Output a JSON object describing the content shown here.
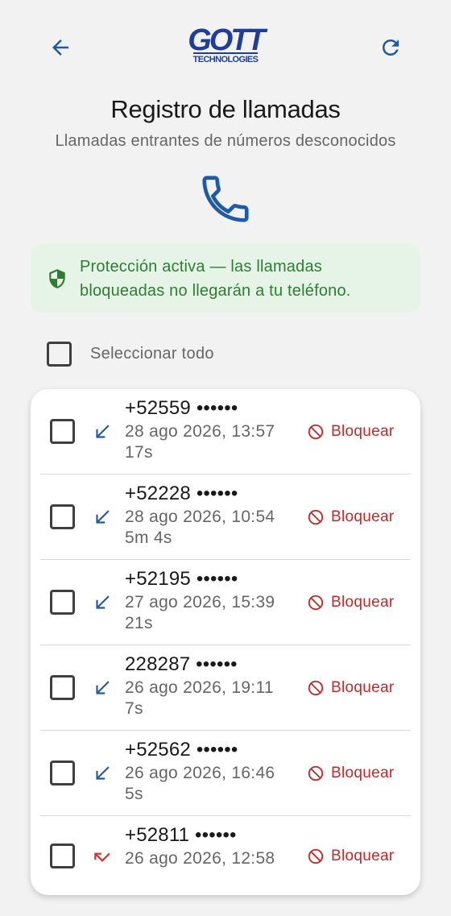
{
  "header": {
    "logo_main": "GOTT",
    "logo_sub": "TECHNOLOGIES",
    "title": "Registro de llamadas",
    "subtitle": "Llamadas entrantes de números desconocidos"
  },
  "banner": {
    "text": "Protección activa — las llamadas bloqueadas no llegarán a tu teléfono."
  },
  "select_all": {
    "label": "Seleccionar todo",
    "checked": false
  },
  "colors": {
    "accent": "#1f5aa6",
    "success": "#2e7d32",
    "danger": "#c62828",
    "missed": "#d32f2f"
  },
  "calls": [
    {
      "number": "+52559 ••••••",
      "date": "28 ago 2026, 13:57",
      "duration": "17s",
      "direction": "incoming",
      "block_label": "Bloquear"
    },
    {
      "number": "+52228 ••••••",
      "date": "28 ago 2026, 10:54",
      "duration": "5m 4s",
      "direction": "incoming",
      "block_label": "Bloquear"
    },
    {
      "number": "+52195 ••••••",
      "date": "27 ago 2026, 15:39",
      "duration": "21s",
      "direction": "incoming",
      "block_label": "Bloquear"
    },
    {
      "number": "228287 ••••••",
      "date": "26 ago 2026, 19:11",
      "duration": "7s",
      "direction": "incoming",
      "block_label": "Bloquear"
    },
    {
      "number": "+52562 ••••••",
      "date": "26 ago 2026, 16:46",
      "duration": "5s",
      "direction": "incoming",
      "block_label": "Bloquear"
    },
    {
      "number": "+52811 ••••••",
      "date": "26 ago 2026, 12:58",
      "duration": "",
      "direction": "missed",
      "block_label": "Bloquear"
    }
  ]
}
